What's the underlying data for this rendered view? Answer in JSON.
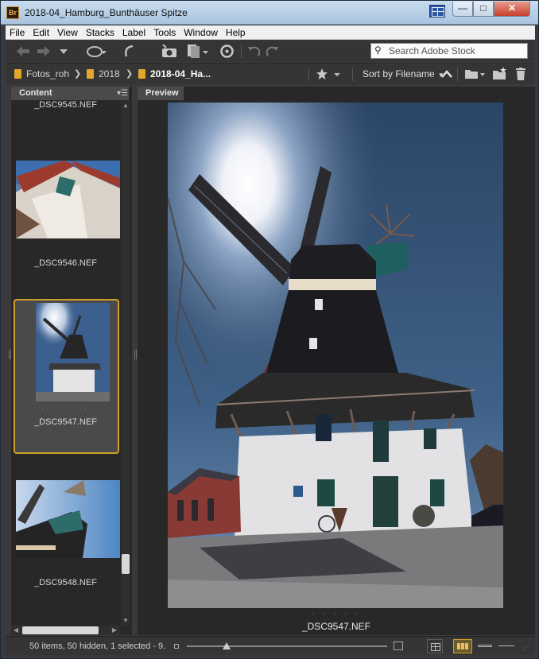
{
  "window": {
    "title": "2018-04_Hamburg_Bunthäuser Spitze",
    "app_icon": "Br",
    "minimize": "—",
    "maximize": "□",
    "close": "✕"
  },
  "menu": [
    "File",
    "Edit",
    "View",
    "Stacks",
    "Label",
    "Tools",
    "Window",
    "Help"
  ],
  "toolbar": {
    "search_placeholder": "Search Adobe Stock",
    "icons": [
      "back-arrow-icon",
      "forward-arrow-icon",
      "history-dropdown-icon",
      "boomerang-icon",
      "return-icon",
      "camera-import-icon",
      "refine-icon",
      "sync-icon",
      "rotate-left-icon",
      "rotate-right-icon"
    ]
  },
  "path": {
    "crumbs": [
      "Fotos_roh",
      "2018",
      "2018-04_Ha..."
    ],
    "sort_label": "Sort by Filename",
    "icons": [
      "star-filter-icon",
      "sort-ascending-icon",
      "open-recent-folder-icon",
      "new-folder-icon",
      "trash-icon"
    ]
  },
  "panels": {
    "content_tab": "Content",
    "preview_tab": "Preview"
  },
  "thumbnails": [
    {
      "name": "_DSC9545.NEF",
      "selected": false,
      "label_stars": ""
    },
    {
      "name": "_DSC9546.NEF",
      "selected": false,
      "label_stars": ""
    },
    {
      "name": "_DSC9547.NEF",
      "selected": true,
      "label_stars": "· · · · ·"
    },
    {
      "name": "_DSC9548.NEF",
      "selected": false,
      "label_stars": ""
    }
  ],
  "preview": {
    "filename": "_DSC9547.NEF",
    "rating_dots": "· · · · ·"
  },
  "status": {
    "text": "50 items, 50 hidden, 1 selected - 9.",
    "thumbnail_size": 0.2
  },
  "colors": {
    "accent": "#d1a02c",
    "panel_bg": "#282828",
    "chrome_bg": "#353535"
  }
}
